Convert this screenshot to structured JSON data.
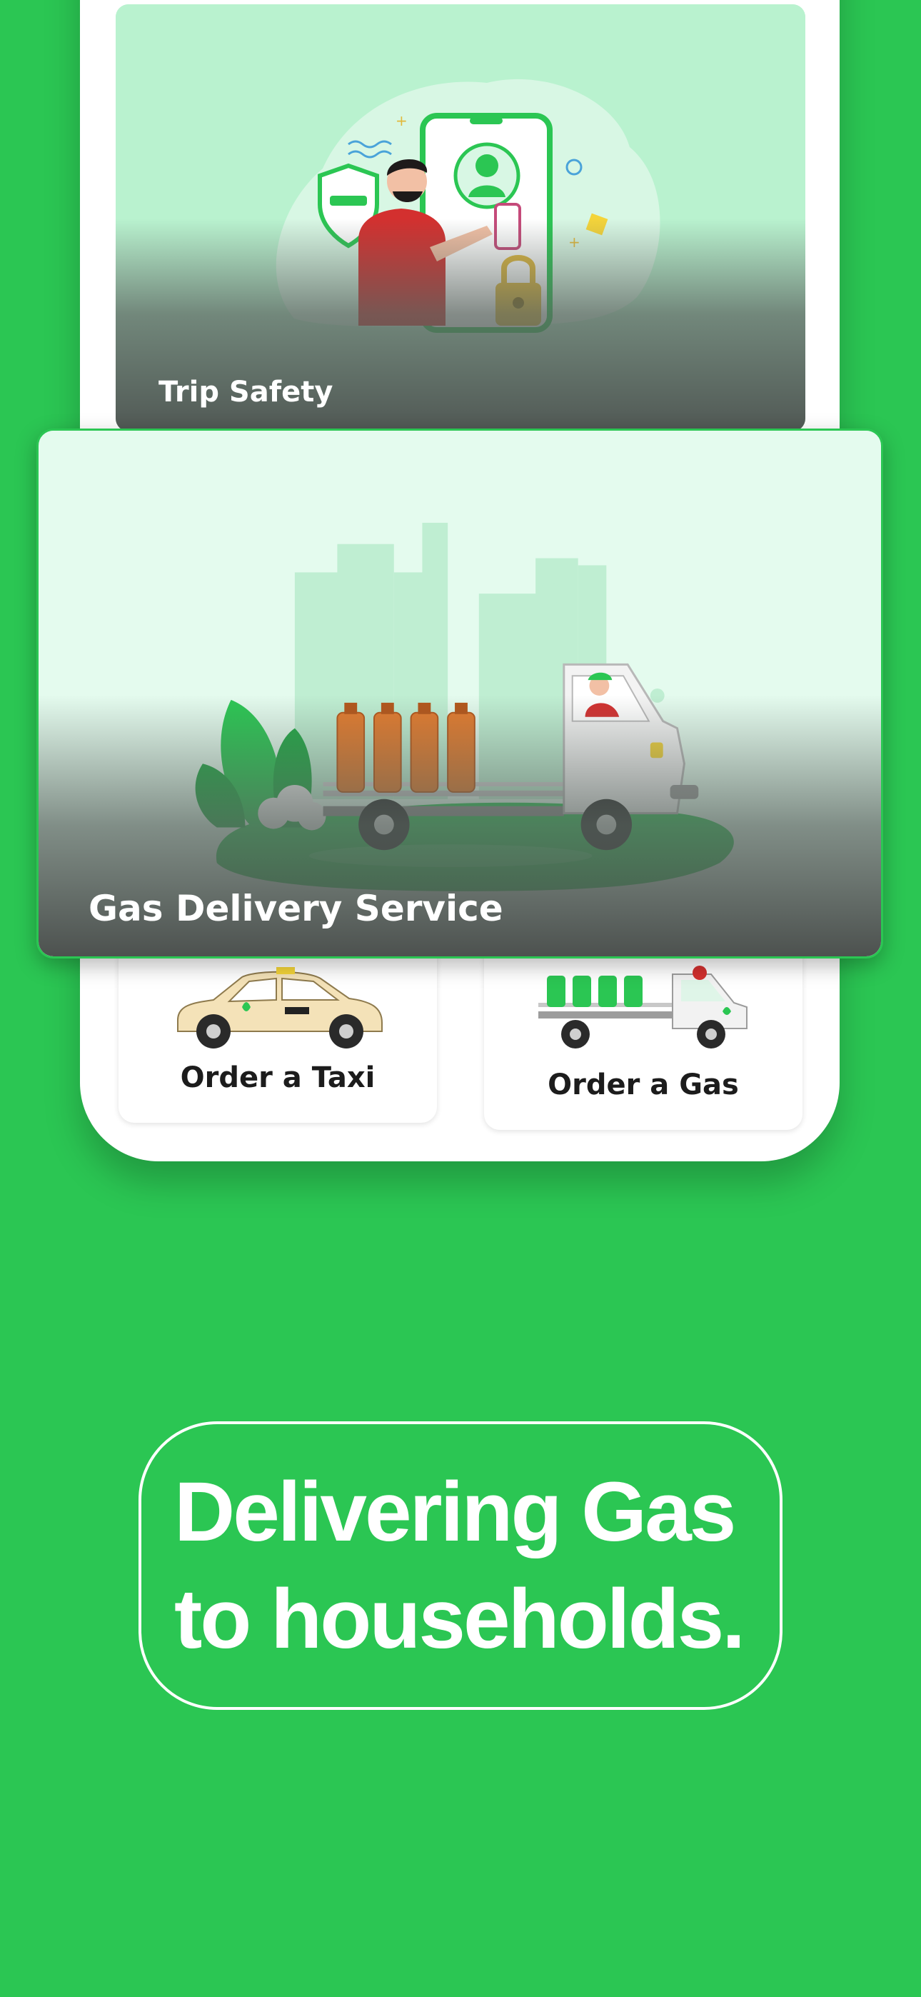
{
  "cards": {
    "trip_safety": {
      "title": "Trip Safety"
    },
    "gas_delivery": {
      "title": "Gas Delivery Service"
    }
  },
  "options": {
    "taxi": {
      "label": "Order a Taxi"
    },
    "gas": {
      "label": "Order a Gas"
    }
  },
  "headline": {
    "line1": "Delivering Gas",
    "line2": "to households."
  },
  "colors": {
    "brand_green": "#2bc653",
    "card_text": "#ffffff",
    "tile_text": "#1c1c1c"
  },
  "icons": {
    "trip_safety_art": "person-with-phone-shield-lock-illustration",
    "gas_delivery_art": "gas-truck-city-illustration",
    "taxi_art": "taxi-car-illustration",
    "gas_art": "gas-truck-illustration"
  }
}
